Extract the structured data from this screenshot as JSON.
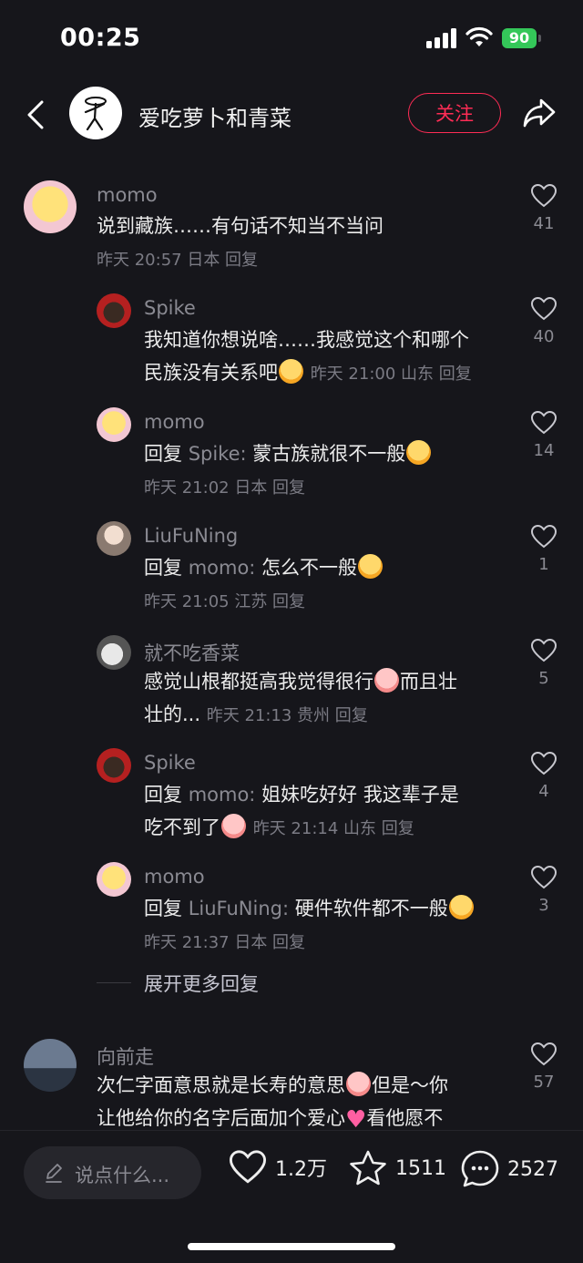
{
  "status_bar": {
    "time": "00:25",
    "battery": "90"
  },
  "header": {
    "author_name": "爱吃萝卜和青菜",
    "follow_label": "关注"
  },
  "comments": [
    {
      "name": "momo",
      "text": "说到藏族……有句话不知当不当问",
      "meta": "昨天 20:57 日本 回复",
      "likes": "41"
    },
    {
      "name": "Spike",
      "text_line1": "我知道你想说啥……我感觉这个和哪个",
      "text_line2": "民族没有关系吧",
      "meta": "昨天 21:00 山东 回复",
      "likes": "40"
    },
    {
      "name": "momo",
      "prefix": "回复",
      "mention": "Spike:",
      "text": "蒙古族就很不一般",
      "meta": "昨天 21:02 日本 回复",
      "likes": "14"
    },
    {
      "name": "LiuFuNing",
      "prefix": "回复",
      "mention": "momo:",
      "text": "怎么不一般",
      "meta": "昨天 21:05 江苏 回复",
      "likes": "1"
    },
    {
      "name": "就不吃香菜",
      "text_line1a": "感觉山根都挺高我觉得很行",
      "text_line1b": "而且壮",
      "text_line2": "壮的...",
      "meta": "昨天 21:13 贵州 回复",
      "likes": "5"
    },
    {
      "name": "Spike",
      "prefix": "回复",
      "mention": "momo:",
      "text_line1": "姐妹吃好好 我这辈子是",
      "text_line2": "吃不到了",
      "meta": "昨天 21:14 山东 回复",
      "likes": "4"
    },
    {
      "name": "momo",
      "prefix": "回复",
      "mention": "LiuFuNing:",
      "text": "硬件软件都不一般",
      "meta": "昨天 21:37 日本 回复",
      "likes": "3"
    },
    {
      "name": "向前走",
      "text_line1a": "次仁字面意思就是长寿的意思",
      "text_line1b": "但是～你",
      "text_line2a": "让他给你的名字后面加个爱心",
      "text_line2b": "看他愿不",
      "likes": "57"
    }
  ],
  "expand_more": "展开更多回复",
  "bottom_bar": {
    "input_placeholder": "说点什么...",
    "likes": "1.2万",
    "favorites": "1511",
    "comments": "2527"
  },
  "colors": {
    "accent": "#fe2c55",
    "background": "#16161b",
    "battery": "#34c759"
  }
}
